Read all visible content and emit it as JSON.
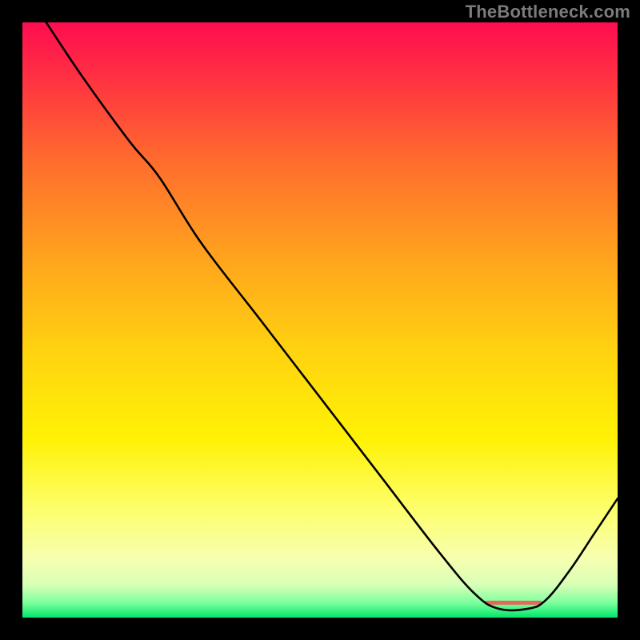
{
  "watermark": "TheBottleneck.com",
  "chart_data": {
    "type": "line",
    "title": "",
    "xlabel": "",
    "ylabel": "",
    "xlim": [
      0,
      100
    ],
    "ylim": [
      0,
      100
    ],
    "grid": false,
    "legend": false,
    "gradient_stops": [
      {
        "offset": 0,
        "color": "#ff0d4f"
      },
      {
        "offset": 0.08,
        "color": "#ff2b44"
      },
      {
        "offset": 0.23,
        "color": "#ff6b2e"
      },
      {
        "offset": 0.4,
        "color": "#ffa51d"
      },
      {
        "offset": 0.55,
        "color": "#ffd210"
      },
      {
        "offset": 0.7,
        "color": "#fff205"
      },
      {
        "offset": 0.82,
        "color": "#fdff6e"
      },
      {
        "offset": 0.9,
        "color": "#f7ffb0"
      },
      {
        "offset": 0.945,
        "color": "#d8ffb6"
      },
      {
        "offset": 0.975,
        "color": "#7dff9e"
      },
      {
        "offset": 1.0,
        "color": "#00e66b"
      }
    ],
    "series": [
      {
        "name": "curve",
        "color": "#000000",
        "width": 2.6,
        "points": [
          {
            "x": 4,
            "y": 100
          },
          {
            "x": 10,
            "y": 91
          },
          {
            "x": 18,
            "y": 80
          },
          {
            "x": 23,
            "y": 74
          },
          {
            "x": 30,
            "y": 63
          },
          {
            "x": 40,
            "y": 50
          },
          {
            "x": 50,
            "y": 37
          },
          {
            "x": 60,
            "y": 24
          },
          {
            "x": 70,
            "y": 11
          },
          {
            "x": 76,
            "y": 4
          },
          {
            "x": 80,
            "y": 1.5
          },
          {
            "x": 85,
            "y": 1.5
          },
          {
            "x": 88,
            "y": 3
          },
          {
            "x": 92,
            "y": 8
          },
          {
            "x": 96,
            "y": 14
          },
          {
            "x": 100,
            "y": 20
          }
        ]
      }
    ],
    "marker_segment": {
      "color": "#e36a5a",
      "y": 2.5,
      "x0": 78,
      "x1": 87,
      "thickness": 5
    }
  }
}
